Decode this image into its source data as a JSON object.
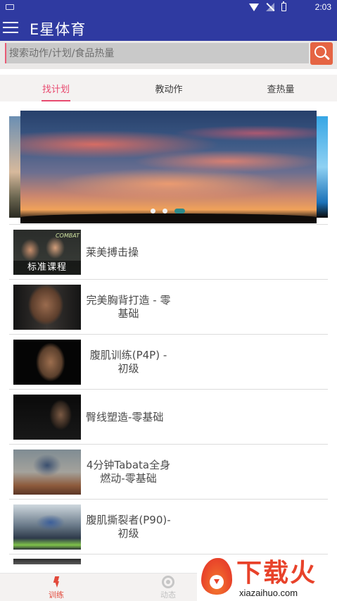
{
  "status_bar": {
    "time": "2:03",
    "icons": [
      "notification-icon",
      "wifi-icon",
      "no-signal-icon",
      "battery-icon"
    ]
  },
  "app_bar": {
    "title": "E星体育",
    "menu_icon": "hamburger-menu-icon"
  },
  "search": {
    "placeholder": "搜索动作/计划/食品热量",
    "value": "",
    "button_icon": "search-icon"
  },
  "tabs": [
    {
      "label": "找计划",
      "active": true
    },
    {
      "label": "教动作",
      "active": false
    },
    {
      "label": "查热量",
      "active": false
    }
  ],
  "banner": {
    "slide_count": 3,
    "active_index": 2
  },
  "plans": [
    {
      "title": "莱美搏击操",
      "thumb_label": "标准课程",
      "thumb_brand": "COMBAT"
    },
    {
      "title": "完美胸背打造 - 零基础"
    },
    {
      "title": "腹肌训练(P4P) - 初级"
    },
    {
      "title": "臀线塑造-零基础"
    },
    {
      "title": "4分钟Tabata全身燃动-零基础"
    },
    {
      "title": "腹肌撕裂者(P90)-初级"
    }
  ],
  "bottom_nav": [
    {
      "label": "训练",
      "icon": "lightning-icon",
      "active": true
    },
    {
      "label": "动态",
      "icon": "compass-icon",
      "active": false
    }
  ],
  "watermark": {
    "text": "下载火",
    "url": "xiazaihuo.com"
  },
  "colors": {
    "primary": "#2f3aa1",
    "accent": "#e84a6f",
    "search_button": "#e56443",
    "nav_active": "#e2493b"
  }
}
